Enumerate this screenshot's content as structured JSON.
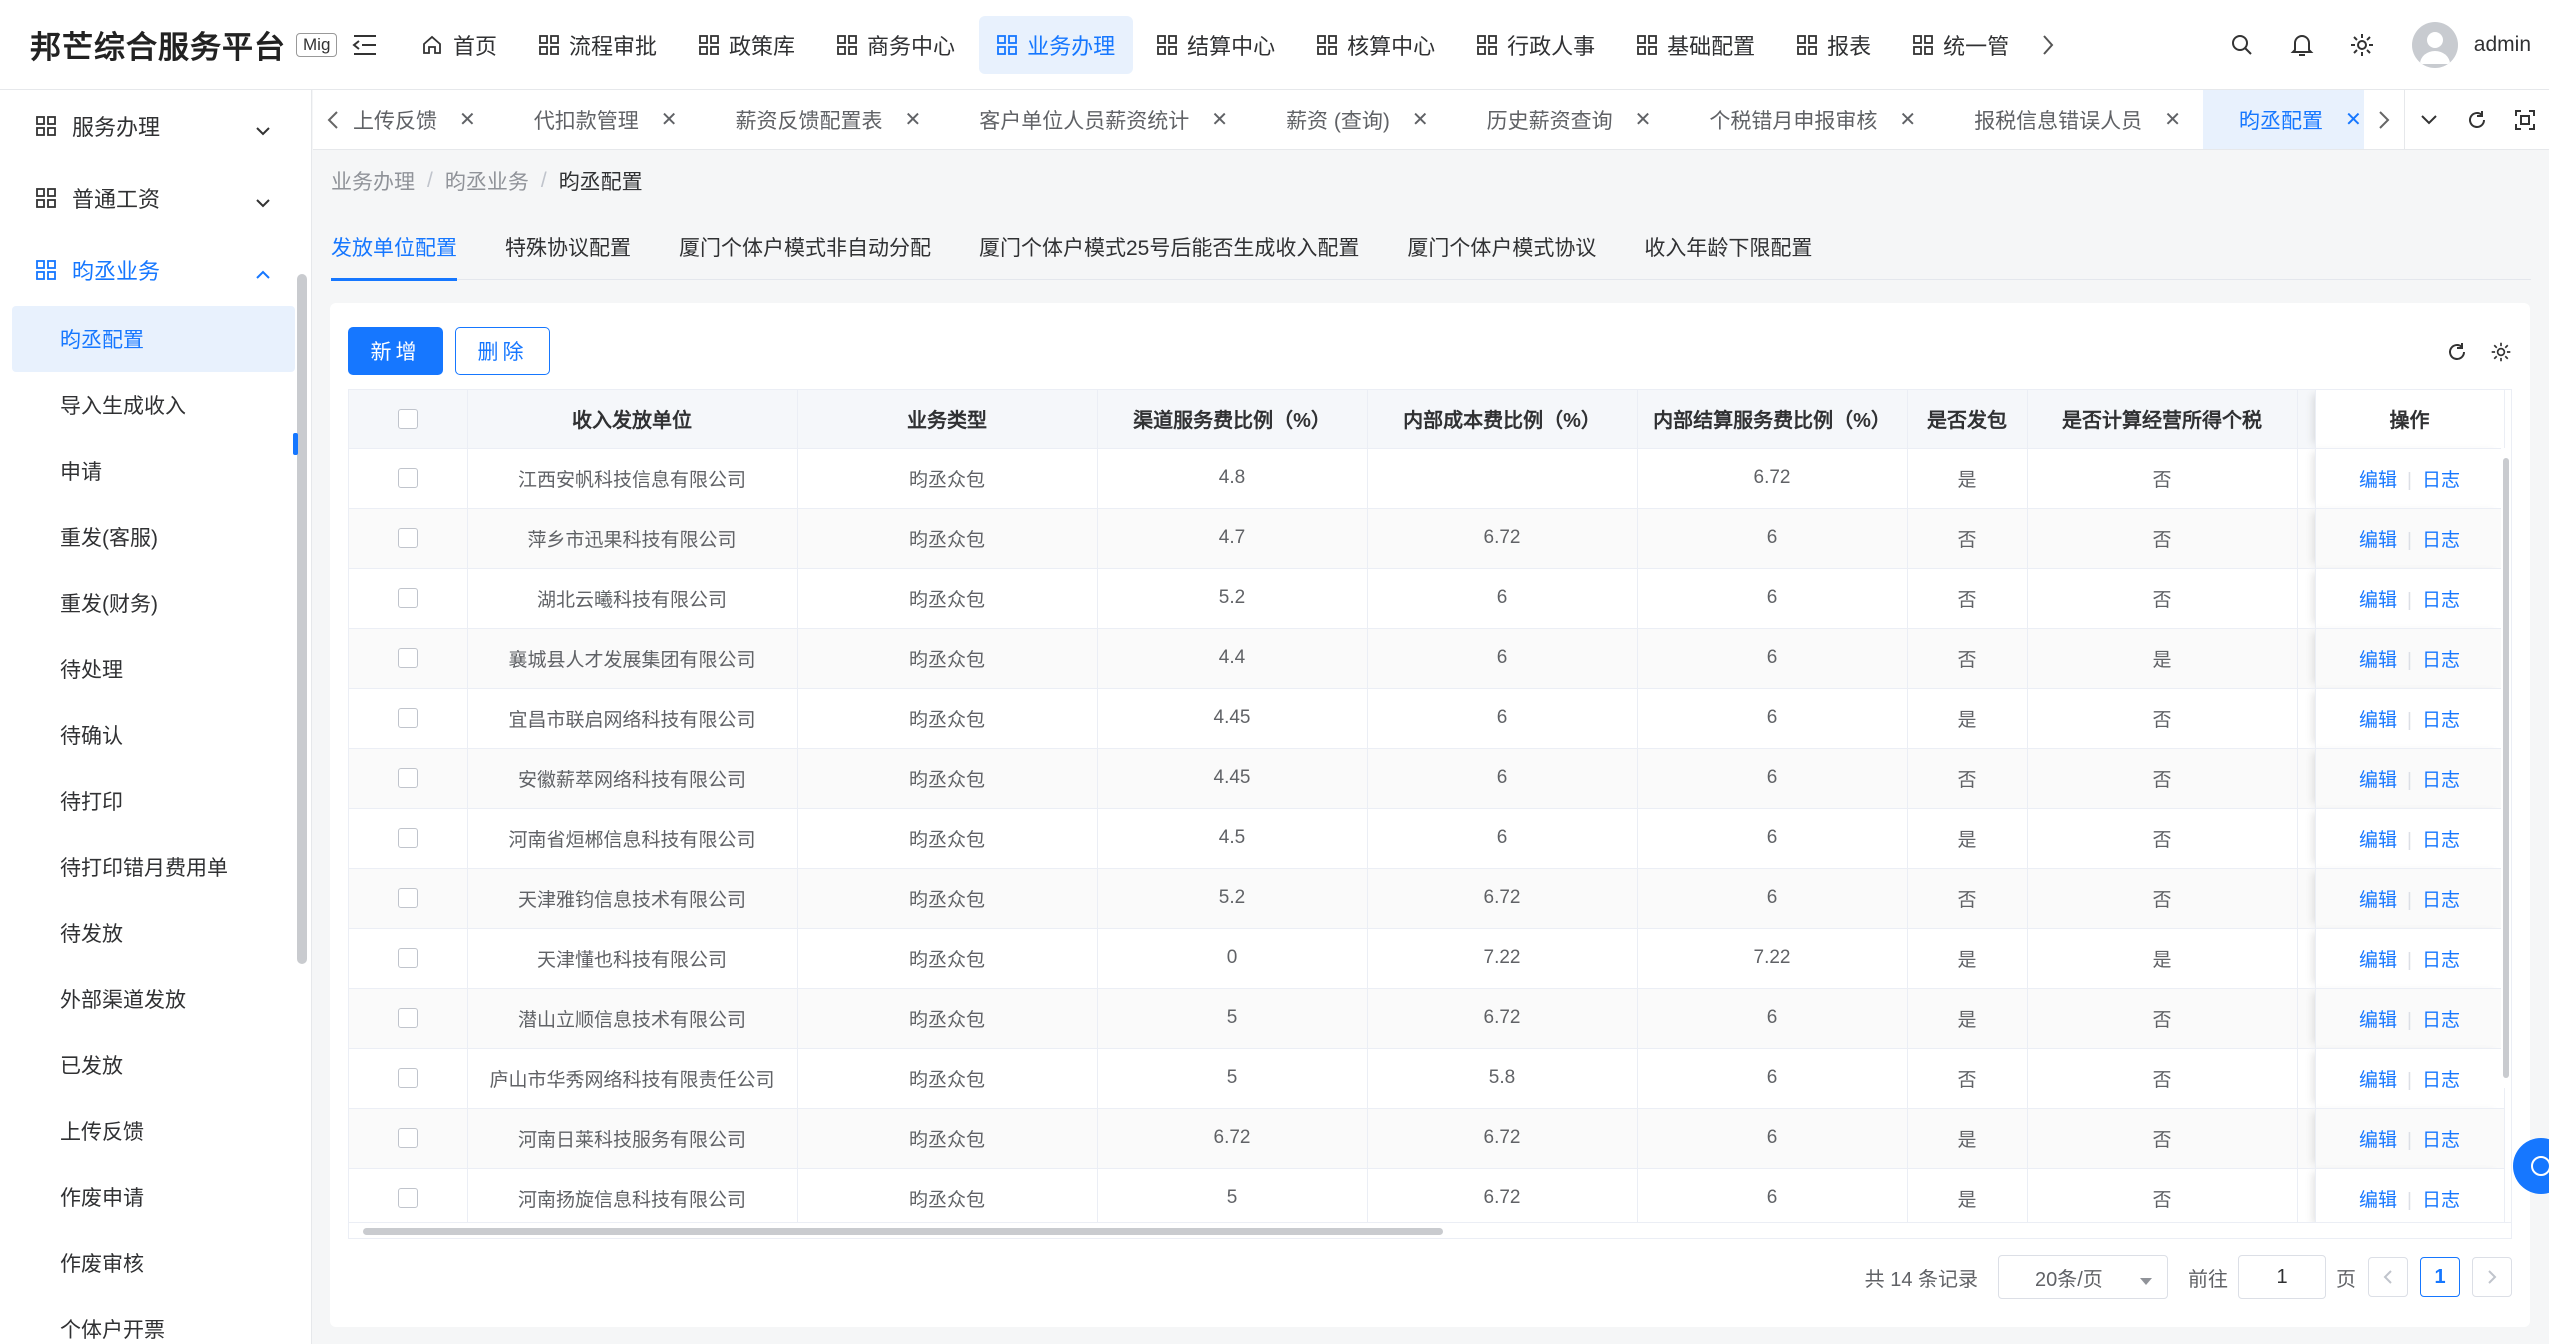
{
  "brand": {
    "title": "邦芒综合服务平台",
    "badge": "Mig"
  },
  "topnav": [
    {
      "label": "首页",
      "icon": "home-icon"
    },
    {
      "label": "流程审批",
      "icon": "grid-icon"
    },
    {
      "label": "政策库",
      "icon": "grid-icon"
    },
    {
      "label": "商务中心",
      "icon": "grid-icon"
    },
    {
      "label": "业务办理",
      "icon": "grid-icon",
      "active": true
    },
    {
      "label": "结算中心",
      "icon": "grid-icon"
    },
    {
      "label": "核算中心",
      "icon": "grid-icon"
    },
    {
      "label": "行政人事",
      "icon": "grid-icon"
    },
    {
      "label": "基础配置",
      "icon": "grid-icon"
    },
    {
      "label": "报表",
      "icon": "grid-icon"
    },
    {
      "label": "统一管",
      "icon": "grid-icon"
    }
  ],
  "user": {
    "name": "admin"
  },
  "sidebar": {
    "groups": [
      {
        "label": "服务办理",
        "open": false
      },
      {
        "label": "普通工资",
        "open": false
      },
      {
        "label": "昀丞业务",
        "open": true
      }
    ],
    "items": [
      {
        "label": "昀丞配置",
        "active": true
      },
      {
        "label": "导入生成收入"
      },
      {
        "label": "申请"
      },
      {
        "label": "重发(客服)"
      },
      {
        "label": "重发(财务)"
      },
      {
        "label": "待处理"
      },
      {
        "label": "待确认"
      },
      {
        "label": "待打印"
      },
      {
        "label": "待打印错月费用单"
      },
      {
        "label": "待发放"
      },
      {
        "label": "外部渠道发放"
      },
      {
        "label": "已发放"
      },
      {
        "label": "上传反馈"
      },
      {
        "label": "作废申请"
      },
      {
        "label": "作废审核"
      },
      {
        "label": "个体户开票"
      }
    ]
  },
  "tabs": [
    {
      "label": "上传反馈"
    },
    {
      "label": "代扣款管理"
    },
    {
      "label": "薪资反馈配置表"
    },
    {
      "label": "客户单位人员薪资统计"
    },
    {
      "label": "薪资 (查询)"
    },
    {
      "label": "历史薪资查询"
    },
    {
      "label": "个税错月申报审核"
    },
    {
      "label": "报税信息错误人员"
    },
    {
      "label": "昀丞配置",
      "active": true
    }
  ],
  "breadcrumb": [
    "业务办理",
    "昀丞业务",
    "昀丞配置"
  ],
  "subtabs": [
    {
      "label": "发放单位配置",
      "active": true
    },
    {
      "label": "特殊协议配置"
    },
    {
      "label": "厦门个体户模式非自动分配"
    },
    {
      "label": "厦门个体户模式25号后能否生成收入配置"
    },
    {
      "label": "厦门个体户模式协议"
    },
    {
      "label": "收入年龄下限配置"
    }
  ],
  "buttons": {
    "add": "新增",
    "delete": "删除"
  },
  "table": {
    "columns": [
      "收入发放单位",
      "业务类型",
      "渠道服务费比例（%）",
      "内部成本费比例（%）",
      "内部结算服务费比例（%）",
      "是否发包",
      "是否计算经营所得个税",
      "操作"
    ],
    "ops": {
      "edit": "编辑",
      "log": "日志"
    },
    "rows": [
      [
        "江西安帆科技信息有限公司",
        "昀丞众包",
        "4.8",
        "",
        "6.72",
        "是",
        "否"
      ],
      [
        "萍乡市迅果科技有限公司",
        "昀丞众包",
        "4.7",
        "6.72",
        "6",
        "否",
        "否"
      ],
      [
        "湖北云曦科技有限公司",
        "昀丞众包",
        "5.2",
        "6",
        "6",
        "否",
        "否"
      ],
      [
        "襄城县人才发展集团有限公司",
        "昀丞众包",
        "4.4",
        "6",
        "6",
        "否",
        "是"
      ],
      [
        "宜昌市联启网络科技有限公司",
        "昀丞众包",
        "4.45",
        "6",
        "6",
        "是",
        "否"
      ],
      [
        "安徽薪萃网络科技有限公司",
        "昀丞众包",
        "4.45",
        "6",
        "6",
        "否",
        "否"
      ],
      [
        "河南省烜郴信息科技有限公司",
        "昀丞众包",
        "4.5",
        "6",
        "6",
        "是",
        "否"
      ],
      [
        "天津雅钧信息技术有限公司",
        "昀丞众包",
        "5.2",
        "6.72",
        "6",
        "否",
        "否"
      ],
      [
        "天津懂也科技有限公司",
        "昀丞众包",
        "0",
        "7.22",
        "7.22",
        "是",
        "是"
      ],
      [
        "潜山立顺信息技术有限公司",
        "昀丞众包",
        "5",
        "6.72",
        "6",
        "是",
        "否"
      ],
      [
        "庐山市华秀网络科技有限责任公司",
        "昀丞众包",
        "5",
        "5.8",
        "6",
        "否",
        "否"
      ],
      [
        "河南日莱科技服务有限公司",
        "昀丞众包",
        "6.72",
        "6.72",
        "6",
        "是",
        "否"
      ],
      [
        "河南扬旋信息科技有限公司",
        "昀丞众包",
        "5",
        "6.72",
        "6",
        "是",
        "否"
      ]
    ]
  },
  "pagination": {
    "total_text": "共 14 条记录",
    "page_size": "20条/页",
    "goto_label": "前往",
    "goto_value": "1",
    "page_unit": "页",
    "current_page": "1"
  },
  "colors": {
    "accent": "#1677ff",
    "accent_bg": "#e8f1fd"
  }
}
